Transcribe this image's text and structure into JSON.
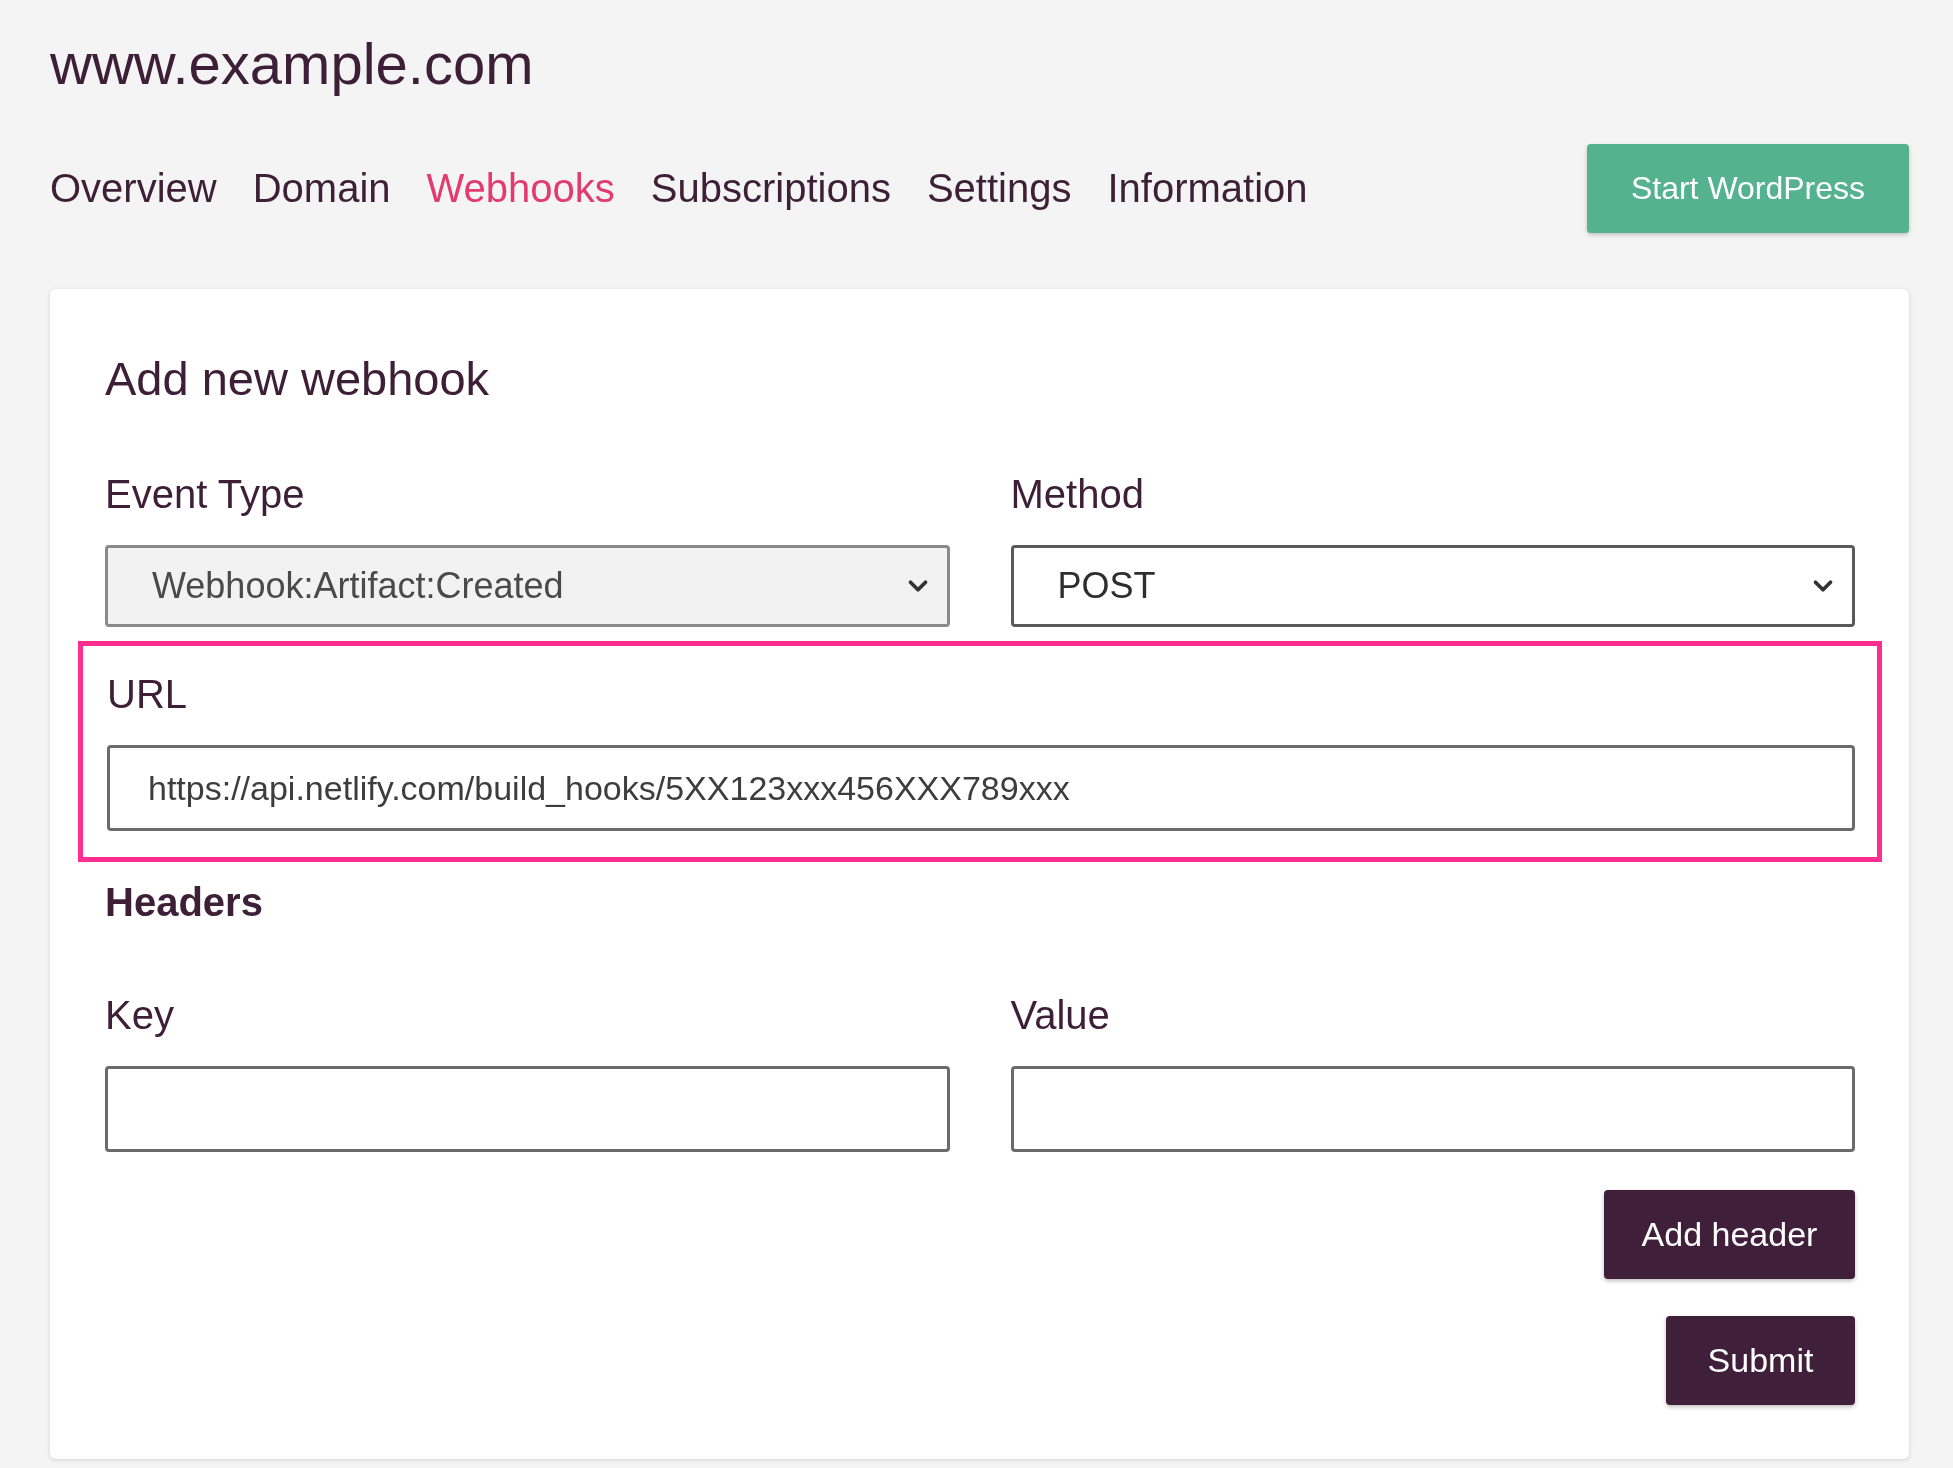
{
  "site_title": "www.example.com",
  "nav": {
    "tabs": [
      {
        "label": "Overview",
        "selected": false
      },
      {
        "label": "Domain",
        "selected": false
      },
      {
        "label": "Webhooks",
        "selected": true
      },
      {
        "label": "Subscriptions",
        "selected": false
      },
      {
        "label": "Settings",
        "selected": false
      },
      {
        "label": "Information",
        "selected": false
      }
    ],
    "action_button": "Start WordPress"
  },
  "form": {
    "title": "Add new webhook",
    "event_type": {
      "label": "Event Type",
      "value": "Webhook:Artifact:Created",
      "disabled": true
    },
    "method": {
      "label": "Method",
      "value": "POST",
      "disabled": false
    },
    "url": {
      "label": "URL",
      "value": "https://api.netlify.com/build_hooks/5XX123xxx456XXX789xxx",
      "highlighted": true
    },
    "headers": {
      "title": "Headers",
      "key_label": "Key",
      "value_label": "Value",
      "add_button": "Add header"
    },
    "submit_button": "Submit"
  }
}
